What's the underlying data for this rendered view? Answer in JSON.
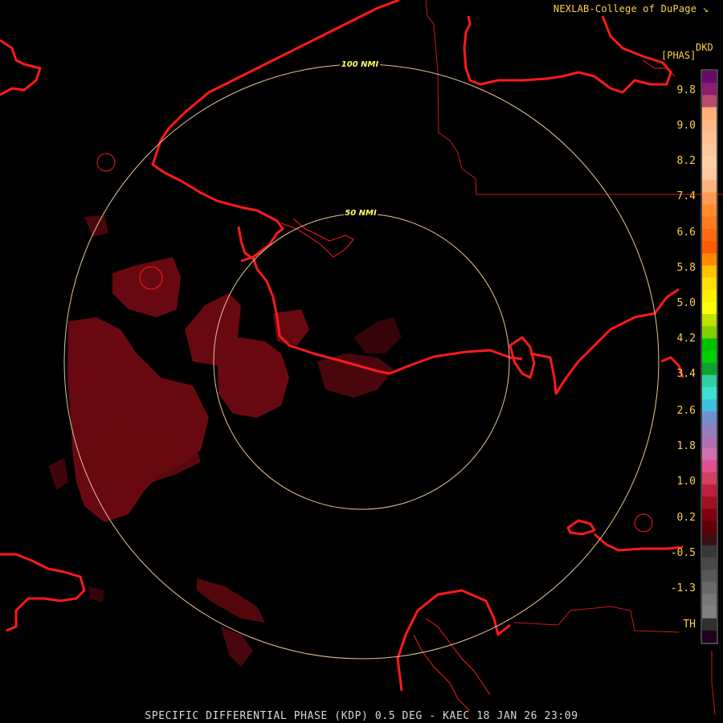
{
  "header": {
    "credit": "NEXLAB-College of DuPage",
    "credit_mark": "↘",
    "product_code": "DKD",
    "units": "[PHAS]"
  },
  "rings": [
    {
      "label": "50 NMI",
      "range_nmi": 50
    },
    {
      "label": "100 NMI",
      "range_nmi": 100
    }
  ],
  "colorbar": {
    "labels": [
      "9.8",
      "9.0",
      "8.2",
      "7.4",
      "6.6",
      "5.8",
      "5.0",
      "4.2",
      "3.4",
      "2.6",
      "1.8",
      "1.0",
      "0.2",
      "-0.5",
      "-1.3",
      "TH"
    ],
    "colors": [
      "#6a0a6a",
      "#8c1e6e",
      "#b84a6c",
      "#ffb07a",
      "#ffb888",
      "#ffc092",
      "#ffc89c",
      "#ffd0a6",
      "#ffc8a0",
      "#ffb080",
      "#ff9a50",
      "#ff8a30",
      "#ff7a20",
      "#ff6a10",
      "#ff5a00",
      "#ff8a00",
      "#ffc000",
      "#ffe000",
      "#fff000",
      "#ffff00",
      "#c0e000",
      "#80d000",
      "#00c000",
      "#00d000",
      "#10a030",
      "#30d0a0",
      "#40e0d0",
      "#40c0e0",
      "#7090d0",
      "#9080c0",
      "#b070b0",
      "#d070b0",
      "#e05090",
      "#d04060",
      "#c02040",
      "#a01020",
      "#800010",
      "#600008",
      "#3a1010",
      "#383838",
      "#484848",
      "#585858",
      "#686868",
      "#787878",
      "#808080",
      "#303030",
      "#200020"
    ]
  },
  "map_colors": {
    "coast": "#ff1a1a",
    "county": "#c81a1a",
    "ring": "#e8c49a",
    "echo": "#6e0a12",
    "label": "#ffd24a"
  },
  "footer": {
    "title": "SPECIFIC DIFFERENTIAL PHASE (KDP) 0.5 DEG - KAEC 18 JAN 26 23:09"
  }
}
